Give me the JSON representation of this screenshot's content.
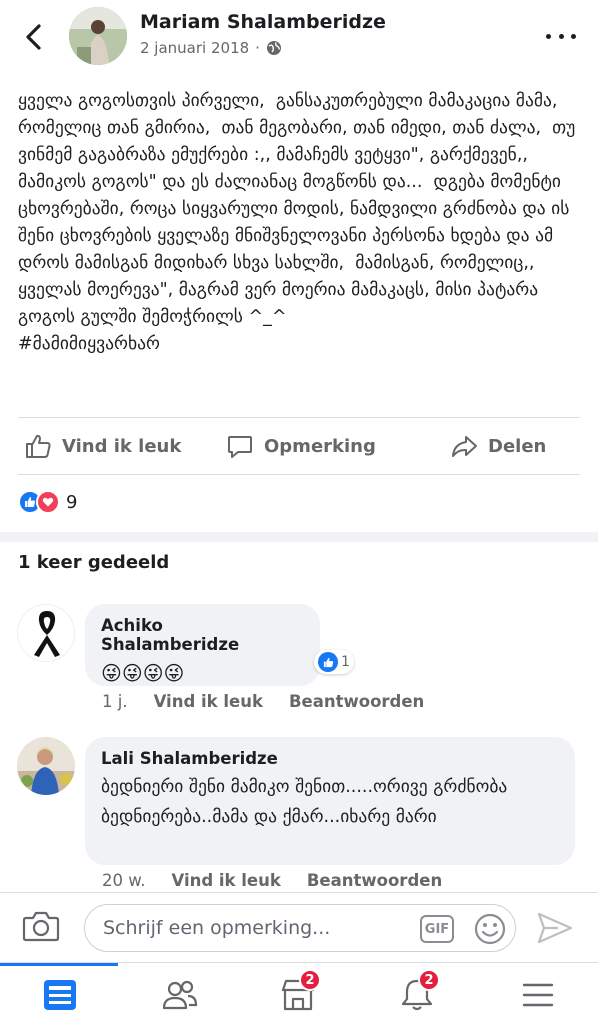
{
  "header": {
    "author": "Mariam Shalamberidze",
    "date": "2 januari 2018",
    "separator": "·"
  },
  "post": {
    "text": "ყველა გოგოსთვის პირველი,  განსაკუთრებული მამაკაცია მამა, რომელიც თან გმირია,  თან მეგობარი, თან იმედი, თან ძალა,  თუ ვინმემ გაგაბრაზა ემუქრები :,, მამაჩემს ვეტყვი\", გარქმევენ,, მამიკოს გოგოს\" და ეს ძალიანაც მოგწონს და...  დგება მომენტი ცხოვრებაში, როცა სიყვარული მოდის, ნამდვილი გრძნობა და ის შენი ცხოვრების ყველაზე მნიშვნელოვანი პერსონა ხდება და ამ დროს მამისგან მიდიხარ სხვა სახლში,  მამისგან, რომელიც,, ყველას მოერევა\", მაგრამ ვერ მოერია მამაკაცს, მისი პატარა გოგოს გულში შემოჭრილს ^_^\n#მამიმიყვარხარ"
  },
  "actions": {
    "like": "Vind ik leuk",
    "comment": "Opmerking",
    "share": "Delen"
  },
  "reactions": {
    "count": "9"
  },
  "shares": {
    "label": "1 keer gedeeld"
  },
  "comments": [
    {
      "name": "Achiko Shalamberidze",
      "text": "😜😜😜😜",
      "time": "1 j.",
      "like": "Vind ik leuk",
      "reply": "Beantwoorden",
      "like_count": "1"
    },
    {
      "name": "Lali Shalamberidze",
      "text": "ბედნიერი  შენი მამიკო შენით.....ორივე გრძნობა ბედნიერება..მამა და ქმარ...იხარე მარი",
      "time": "20 w.",
      "like": "Vind ik leuk",
      "reply": "Beantwoorden"
    }
  ],
  "composer": {
    "placeholder": "Schrijf een opmerking...",
    "gif": "GIF"
  },
  "nav": {
    "marketplace_badge": "2",
    "notifications_badge": "2"
  },
  "colors": {
    "accent": "#1877f2",
    "badge": "#e41e3f",
    "love": "#f33e58",
    "secondary_text": "#65676b"
  }
}
